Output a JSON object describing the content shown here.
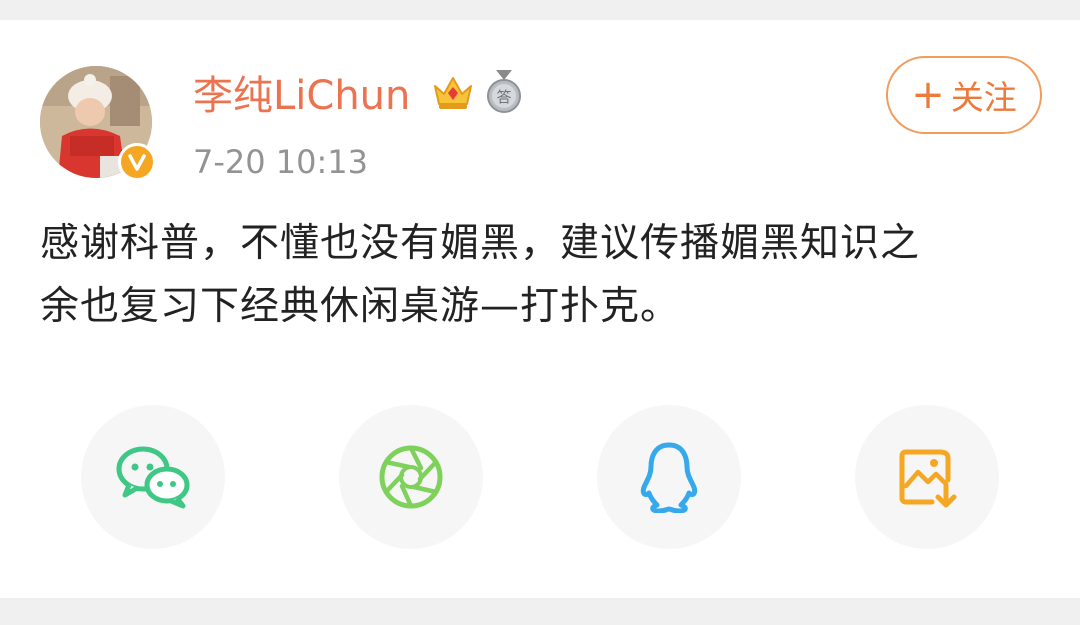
{
  "post": {
    "username": "李纯LiChun",
    "timestamp": "7-20 10:13",
    "follow_button": {
      "plus": "+",
      "label": "关注"
    },
    "text_lines": [
      "感谢科普，不懂也没有媚黑，建议传播媚黑知识之",
      "余也复习下经典休闲桌游—打扑克。"
    ],
    "badges": [
      "crown-badge-icon",
      "answer-badge-icon"
    ],
    "answer_badge_text": "答",
    "verified_icon": "verified-v-icon",
    "verified_text": "V"
  },
  "share_options": [
    {
      "name": "wechat",
      "icon": "wechat-icon"
    },
    {
      "name": "moments",
      "icon": "moments-aperture-icon"
    },
    {
      "name": "qq",
      "icon": "qq-penguin-icon"
    },
    {
      "name": "save-image",
      "icon": "save-image-icon"
    }
  ],
  "colors": {
    "username": "#eb7350",
    "follow_border": "#f29b5a",
    "timestamp": "#939393",
    "text": "#222222",
    "wechat": "#3ec785",
    "moments": "#7ed15a",
    "qq": "#36a9ec",
    "save_image": "#f5a623"
  }
}
